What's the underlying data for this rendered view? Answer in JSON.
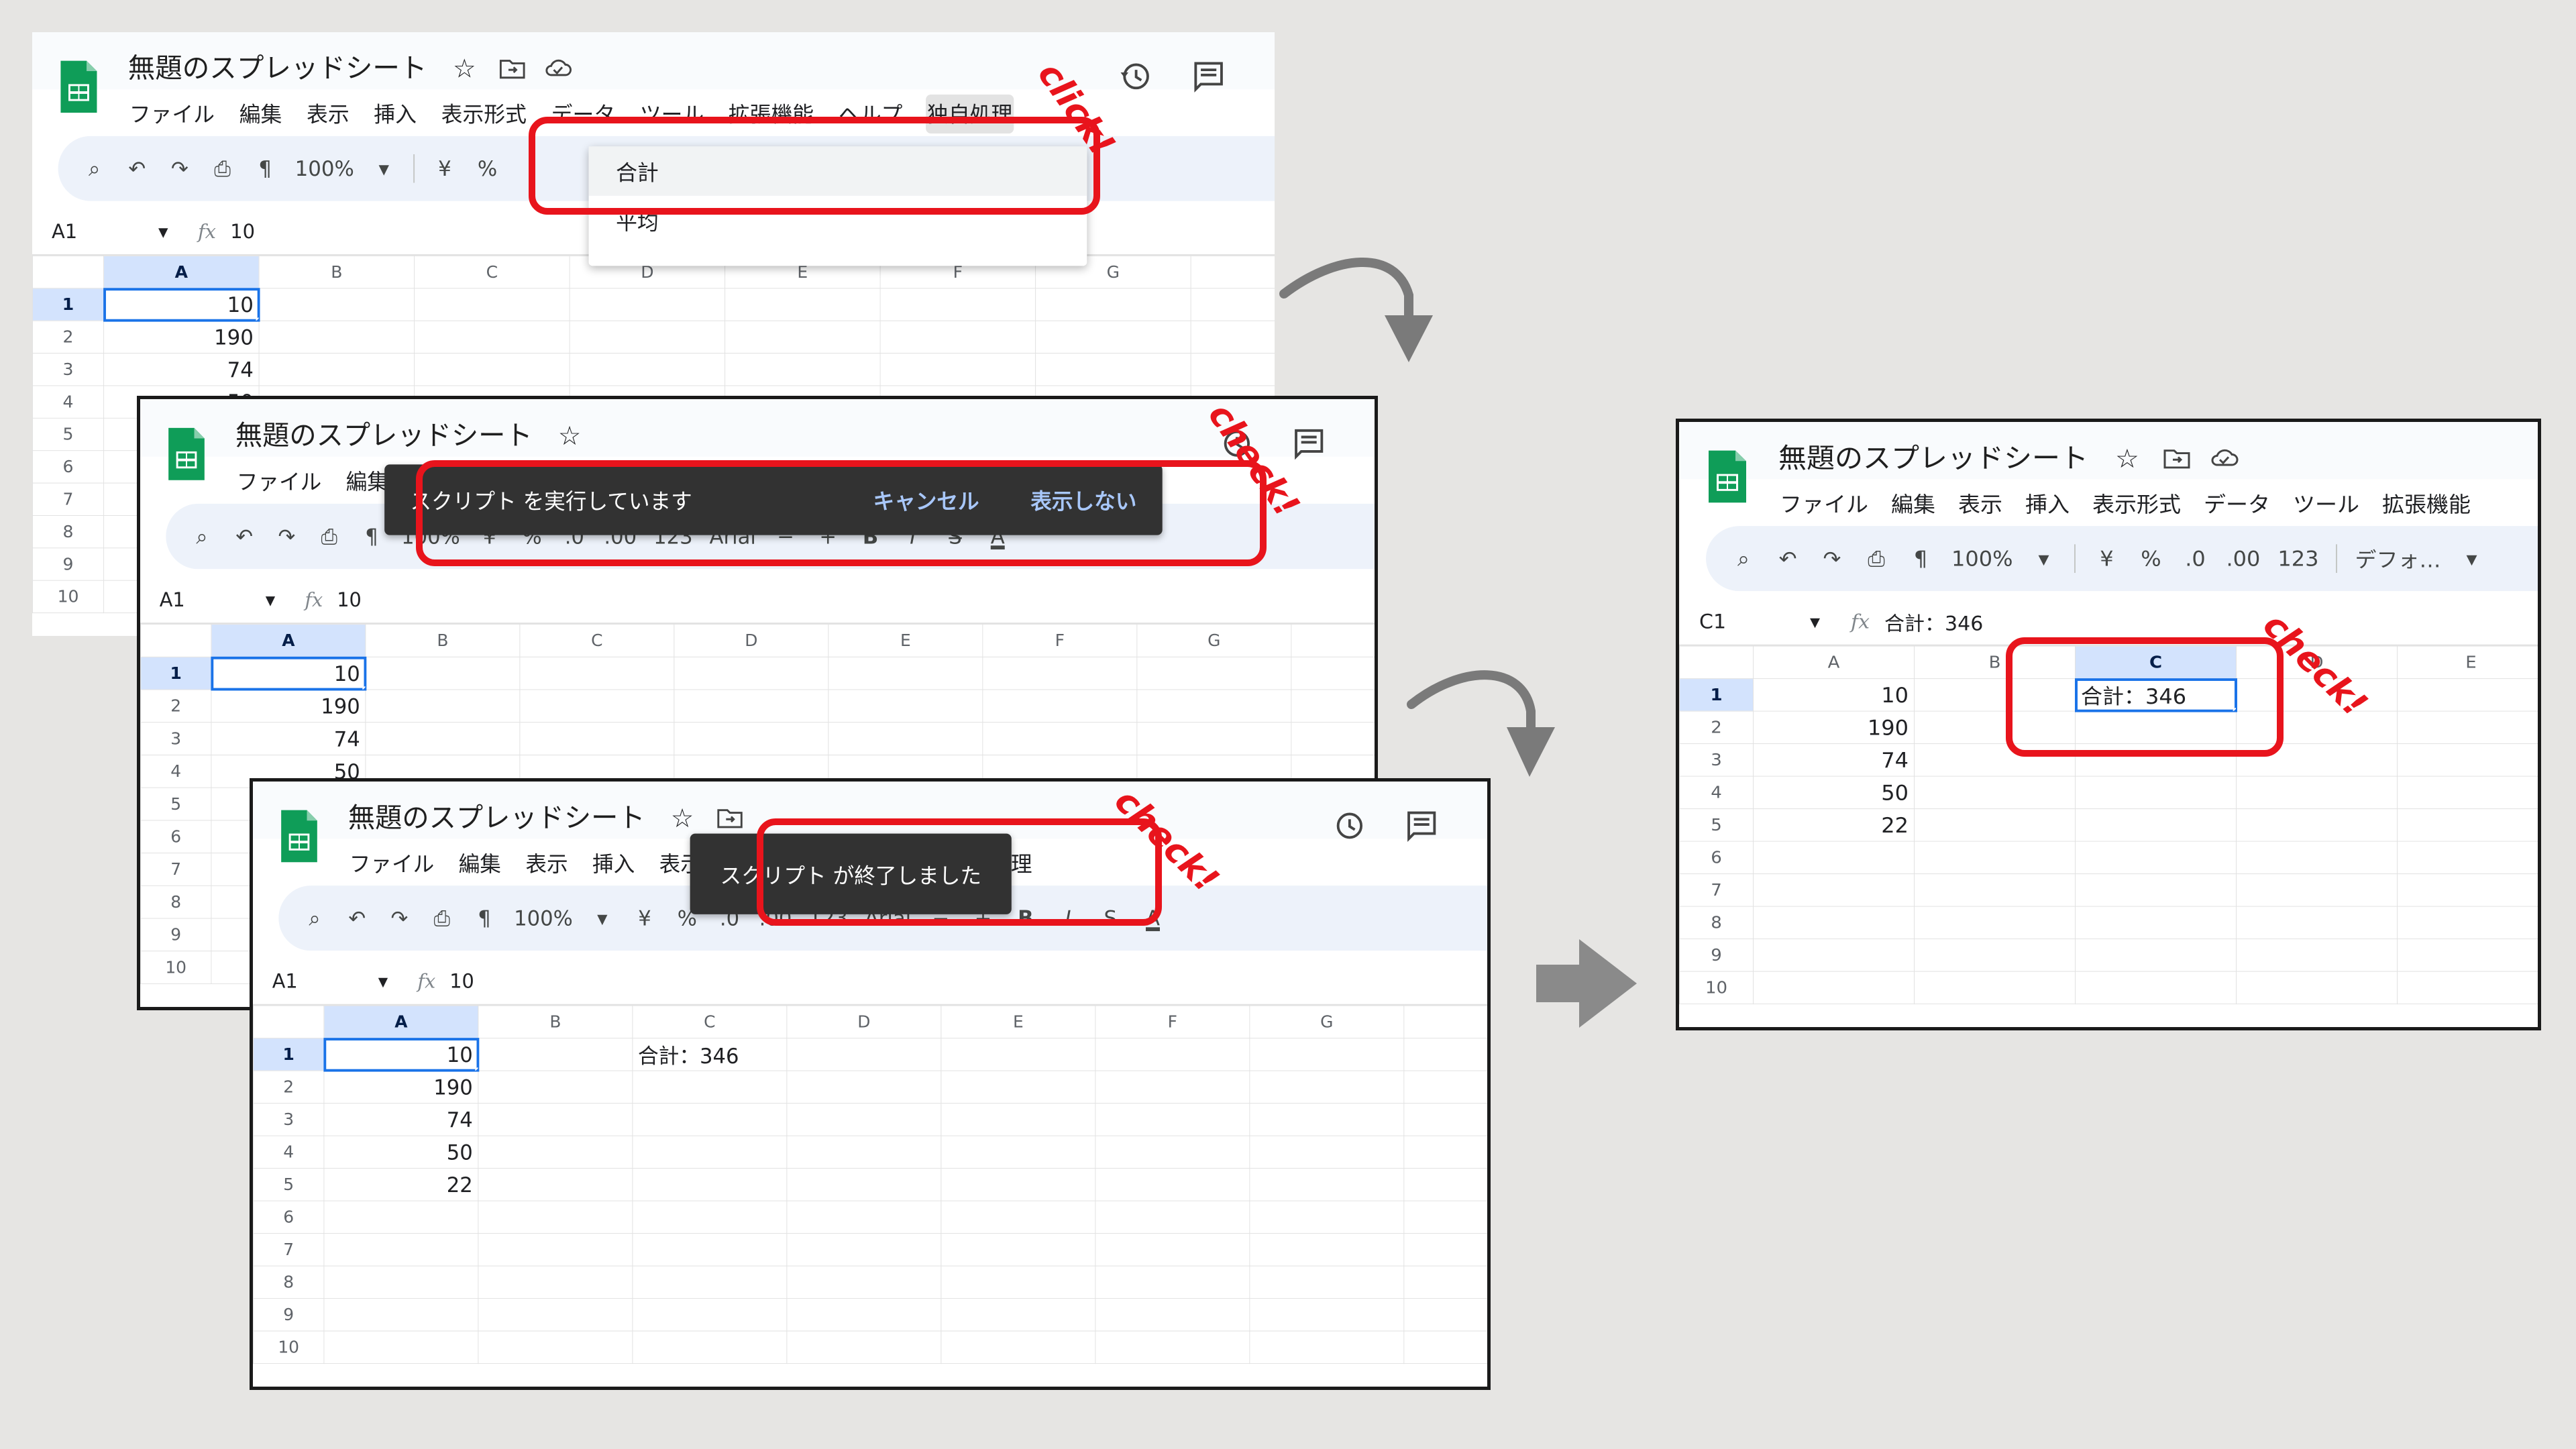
{
  "title": "無題のスプレッドシート",
  "menus": [
    "ファイル",
    "編集",
    "表示",
    "挿入",
    "表示形式",
    "データ",
    "ツール",
    "拡張機能",
    "ヘルプ",
    "独自処理"
  ],
  "toolbar": {
    "zoom": "100%",
    "yen": "¥",
    "percent": "%",
    "dec_minus": ".0",
    "dec_plus": ".00",
    "num123": "123",
    "font": "Arial",
    "font_default": "デフォ…",
    "bold": "B",
    "italic": "I",
    "minus": "−",
    "plus": "+",
    "textcolor": "A"
  },
  "formula1": {
    "ref": "A1",
    "fx": "fx",
    "value": "10"
  },
  "formula4": {
    "ref": "C1",
    "fx": "fx",
    "value": "合計：346"
  },
  "columns": [
    "A",
    "B",
    "C",
    "D",
    "E",
    "F",
    "G"
  ],
  "rows": [
    "1",
    "2",
    "3",
    "4",
    "5",
    "6",
    "7",
    "8",
    "9",
    "10"
  ],
  "values": [
    "10",
    "190",
    "74",
    "50",
    "22"
  ],
  "result": "合計：346",
  "dropdown": {
    "item1": "合計",
    "item2": "平均"
  },
  "toast_running": {
    "text": "スクリプト を実行しています",
    "cancel": "キャンセル",
    "hide": "表示しない"
  },
  "toast_done": {
    "text": "スクリプト が終了しました"
  },
  "annotations": {
    "click": "click!",
    "check": "check!"
  },
  "colors": {
    "highlight": "#e8141c",
    "sheets_green": "#0f9d58",
    "selection": "#1a73e8",
    "header_sel": "#d3e3fd"
  }
}
